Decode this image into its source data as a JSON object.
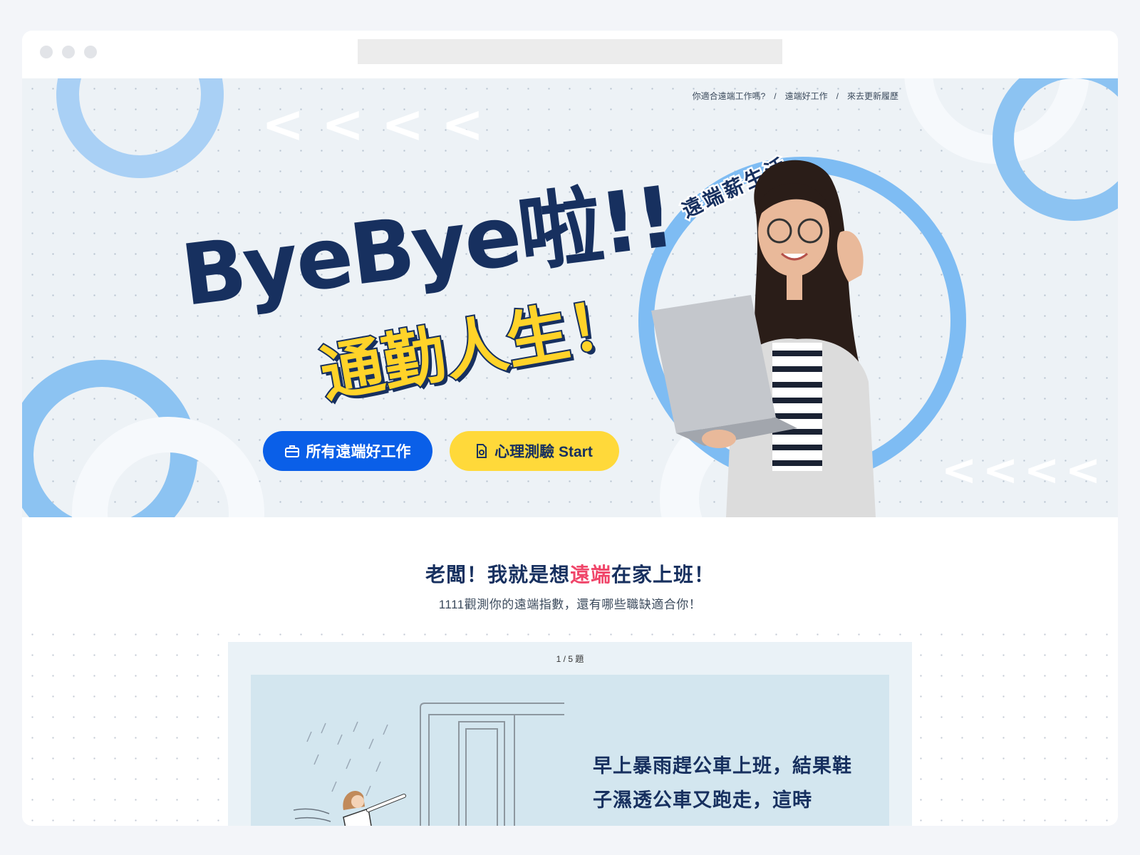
{
  "breadcrumb": [
    "你適合遠端工作嗎?",
    "遠端好工作",
    "來去更新履歷"
  ],
  "hero": {
    "headline": "ByeBye啦!!",
    "subheadline": "通勤人生！",
    "tagline": "遠端薪生活",
    "btn_jobs": "所有遠端好工作",
    "btn_quiz": "心理測驗 Start"
  },
  "intro": {
    "title_before": "老闆！我就是想",
    "title_highlight": "遠端",
    "title_after": "在家上班！",
    "subtitle": "1111觀測你的遠端指數，還有哪些職缺適合你！"
  },
  "quiz": {
    "counter": "1 / 5 題",
    "question": "早上暴雨趕公車上班，結果鞋子濕透公車又跑走，這時"
  },
  "colors": {
    "navy": "#17305f",
    "accent_blue": "#0a5fe8",
    "accent_yellow": "#ffd93a",
    "highlight_pink": "#f0466a"
  },
  "icons": [
    "briefcase-icon",
    "document-icon"
  ]
}
